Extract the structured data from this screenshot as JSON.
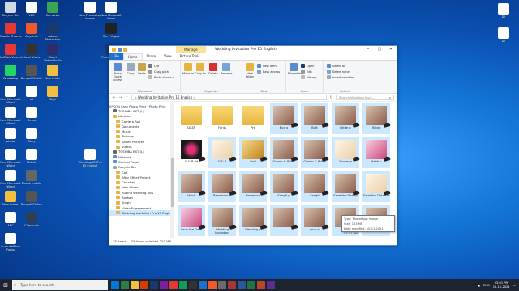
{
  "desktop": {
    "icons": [
      {
        "label": "Recycle Bin",
        "color": "#cfd8e3",
        "col": 0,
        "row": 0
      },
      {
        "label": "Google Chrome",
        "color": "#e53935",
        "col": 0,
        "row": 1
      },
      {
        "label": "YouTube Vanced",
        "color": "#e53935",
        "col": 0,
        "row": 2
      },
      {
        "label": "WhatsApp",
        "color": "#25d366",
        "col": 0,
        "row": 3
      },
      {
        "label": "New Microsoft Word",
        "color": "#ffffff",
        "col": 0,
        "row": 4
      },
      {
        "label": "New Microsoft Word",
        "color": "#ffffff",
        "col": 0,
        "row": 5
      },
      {
        "label": "photo",
        "color": "#ffffff",
        "col": 0,
        "row": 6
      },
      {
        "label": "New Microsoft Word",
        "color": "#ffffff",
        "col": 0,
        "row": 7
      },
      {
        "label": "New Microsoft Word",
        "color": "#ffffff",
        "col": 0,
        "row": 8
      },
      {
        "label": "New folder",
        "color": "#f1c040",
        "col": 0,
        "row": 9
      },
      {
        "label": "ABC",
        "color": "#ffffff",
        "col": 0,
        "row": 10
      },
      {
        "label": "AndrukeWork Fonts",
        "color": "#ffffff",
        "col": 0,
        "row": 11
      },
      {
        "label": "VLC",
        "color": "#ffffff",
        "col": 1,
        "row": 0
      },
      {
        "label": "Anydesk",
        "color": "#ef5a2a",
        "col": 1,
        "row": 1
      },
      {
        "label": "Rasel Video",
        "color": "#333333",
        "col": 1,
        "row": 2
      },
      {
        "label": "Bengali Mobile",
        "color": "#555555",
        "col": 1,
        "row": 3
      },
      {
        "label": "ad",
        "color": "#ffffff",
        "col": 1,
        "row": 4
      },
      {
        "label": "Demo",
        "color": "#ffffff",
        "col": 1,
        "row": 5
      },
      {
        "label": "Sony",
        "color": "#ffffff",
        "col": 1,
        "row": 6
      },
      {
        "label": "Mobile",
        "color": "#ffffff",
        "col": 1,
        "row": 7
      },
      {
        "label": "Ebook mobile",
        "color": "#666666",
        "col": 1,
        "row": 8
      },
      {
        "label": "Bengali Stylish",
        "color": "#555555",
        "col": 1,
        "row": 9
      },
      {
        "label": "Clipstudio",
        "color": "#2d3f55",
        "col": 1,
        "row": 10
      },
      {
        "label": "Camtasia",
        "color": "#3aa655",
        "col": 2,
        "row": 0
      },
      {
        "label": "Adobe Photoshop",
        "color": "#1a3a6e",
        "col": 2,
        "row": 1
      },
      {
        "label": "Corel VideoStudio",
        "color": "#2d2d6e",
        "col": 2,
        "row": 2
      },
      {
        "label": "New folder",
        "color": "#f1c040",
        "col": 2,
        "row": 3
      },
      {
        "label": "Sigh",
        "color": "#f1c040",
        "col": 2,
        "row": 4
      },
      {
        "label": "Sony Vegas",
        "color": "#222222",
        "col": 3,
        "row": 1
      },
      {
        "label": "Photoshop CC",
        "color": "#1a3a6e",
        "col": 3,
        "row": 2
      },
      {
        "label": "New Microsoft Word",
        "color": "#ffffff",
        "col": 3,
        "row": 0
      },
      {
        "label": "ABC",
        "color": "#ffffff",
        "col": 5,
        "row": 4
      },
      {
        "label": "New Photoshop Image",
        "color": "#ffffff",
        "col": 4,
        "row": 0
      },
      {
        "label": "WeddingAIM Pro 15 English",
        "color": "#ffffff",
        "col": 4,
        "row": 7
      }
    ],
    "right_icons": [
      {
        "label": "Dll",
        "color": "#ffffff"
      },
      {
        "label": "Dll",
        "color": "#ffffff"
      }
    ]
  },
  "window": {
    "title": "Wedding Invitation Pro 15 English",
    "context_tab": "Manage",
    "tabs": [
      "File",
      "Home",
      "Share",
      "View",
      "Picture Tools"
    ],
    "ribbon": {
      "clipboard": {
        "label": "Clipboard",
        "pin": "Pin to Quick access",
        "copy": "Copy",
        "paste": "Paste",
        "cut": "Cut",
        "copy_path": "Copy path",
        "paste_shortcut": "Paste shortcut"
      },
      "organize": {
        "label": "Organize",
        "move_to": "Move to",
        "copy_to": "Copy to",
        "delete": "Delete",
        "rename": "Rename"
      },
      "new": {
        "label": "New",
        "new_folder": "New folder",
        "new_item": "New item",
        "easy_access": "Easy access"
      },
      "open": {
        "label": "Open",
        "properties": "Properties",
        "open": "Open",
        "edit": "Edit",
        "history": "History"
      },
      "select": {
        "label": "Select",
        "select_all": "Select all",
        "select_none": "Select none",
        "invert": "Invert selection"
      }
    },
    "address": {
      "path": "›  Wedding Invitation Pro 15 English  ›",
      "search_placeholder": "Search Wedding Invit..."
    },
    "epson": "EPSON  Easy Photo Print  ·  Photo Print",
    "nav_items": [
      {
        "label": "TOSHIBA EXT (L)",
        "color": "#666666",
        "sel": false
      },
      {
        "label": "Libraries",
        "color": "#e6b53f",
        "sel": false
      },
      {
        "label": "Camera Roll",
        "color": "#e6b53f",
        "sel": false
      },
      {
        "label": "Documents",
        "color": "#e6b53f",
        "sel": false
      },
      {
        "label": "Music",
        "color": "#e6b53f",
        "sel": false
      },
      {
        "label": "Pictures",
        "color": "#e6b53f",
        "sel": false
      },
      {
        "label": "Saved Pictures",
        "color": "#e6b53f",
        "sel": false
      },
      {
        "label": "Videos",
        "color": "#e6b53f",
        "sel": false
      },
      {
        "label": "TOSHIBA EXT (L)",
        "color": "#666666",
        "sel": false
      },
      {
        "label": "Network",
        "color": "#5a8bd0",
        "sel": false
      },
      {
        "label": "Control Panel",
        "color": "#5a8bd0",
        "sel": false
      },
      {
        "label": "Recycle Bin",
        "color": "#9aa3ad",
        "sel": false
      },
      {
        "label": "Cat",
        "color": "#e6b53f",
        "sel": false
      },
      {
        "label": "After Effect Project",
        "color": "#e6b53f",
        "sel": false
      },
      {
        "label": "Chaahat",
        "color": "#e6b53f",
        "sel": false
      },
      {
        "label": "New folder",
        "color": "#e6b53f",
        "sel": false
      },
      {
        "label": "Rubina wedding pics",
        "color": "#e6b53f",
        "sel": false
      },
      {
        "label": "Roshan",
        "color": "#e6b53f",
        "sel": false
      },
      {
        "label": "Singh",
        "color": "#e6b53f",
        "sel": false
      },
      {
        "label": "Video Engagement",
        "color": "#e6b53f",
        "sel": false
      },
      {
        "label": "Wedding Invitation Pro 15 English",
        "color": "#e6b53f",
        "sel": true
      }
    ],
    "files": [
      {
        "name": "DATA",
        "type": "folder",
        "sel": false
      },
      {
        "name": "Fonts",
        "type": "folder",
        "sel": false
      },
      {
        "name": "Pro",
        "type": "folder",
        "sel": false
      },
      {
        "name": "Bud p",
        "type": "photo",
        "sel": true
      },
      {
        "name": "Butt",
        "type": "photo",
        "sel": true
      },
      {
        "name": "Bride p",
        "type": "photo",
        "sel": true
      },
      {
        "name": "Bride",
        "type": "photo",
        "sel": true
      },
      {
        "name": "G & B dd",
        "type": "dark",
        "sel": false
      },
      {
        "name": "G & B",
        "type": "cream",
        "sel": true
      },
      {
        "name": "God",
        "type": "gold",
        "sel": true
      },
      {
        "name": "Groom & Bride",
        "type": "photo",
        "sel": true
      },
      {
        "name": "Groom & Bride",
        "type": "photo",
        "sel": true
      },
      {
        "name": "Groom p",
        "type": "cream",
        "sel": true
      },
      {
        "name": "Haldi p",
        "type": "pink",
        "sel": true
      },
      {
        "name": "Haldi",
        "type": "photo",
        "sel": true
      },
      {
        "name": "Reception p",
        "type": "photo",
        "sel": true
      },
      {
        "name": "Reception",
        "type": "photo",
        "sel": true
      },
      {
        "name": "Sangit p",
        "type": "photo",
        "sel": true
      },
      {
        "name": "Sangit",
        "type": "photo",
        "sel": true
      },
      {
        "name": "Save the Date p",
        "type": "photo",
        "sel": true
      },
      {
        "name": "Save the Date txt",
        "type": "cream",
        "sel": true
      },
      {
        "name": "Save the Date",
        "type": "pink",
        "sel": true
      },
      {
        "name": "Wedding Invitation",
        "type": "photo",
        "sel": true
      },
      {
        "name": "Wedding p",
        "type": "photo",
        "sel": true
      },
      {
        "name": "",
        "type": "blank",
        "sel": true
      },
      {
        "name": "your p",
        "type": "photo",
        "sel": true
      },
      {
        "name": "",
        "type": "blank",
        "sel": true
      },
      {
        "name": "",
        "type": "blank",
        "sel": true
      }
    ],
    "tooltip": {
      "line1": "Type: Photoshop image",
      "line2": "Size: 123 MB",
      "line3": "Date modified: 10-11-2021 07:22 PM"
    },
    "status": {
      "items": "28 items",
      "selected": "25 items selected  255 MB"
    }
  },
  "taskbar": {
    "search_placeholder": "Type here to search",
    "apps": [
      "#0078d7",
      "#2d7d46",
      "#f1c040",
      "#d83b01",
      "#1a3a6e",
      "#7a1fa2",
      "#e53935",
      "#0f9d58",
      "#333333",
      "#1e6fd0",
      "#ef5a2a",
      "#6b6b6b",
      "#a4373a",
      "#2b579a",
      "#217346",
      "#b7472a",
      "#5c2d91"
    ],
    "lang": "ENG",
    "time": "03:01 PM",
    "date": "15-11-2021"
  }
}
